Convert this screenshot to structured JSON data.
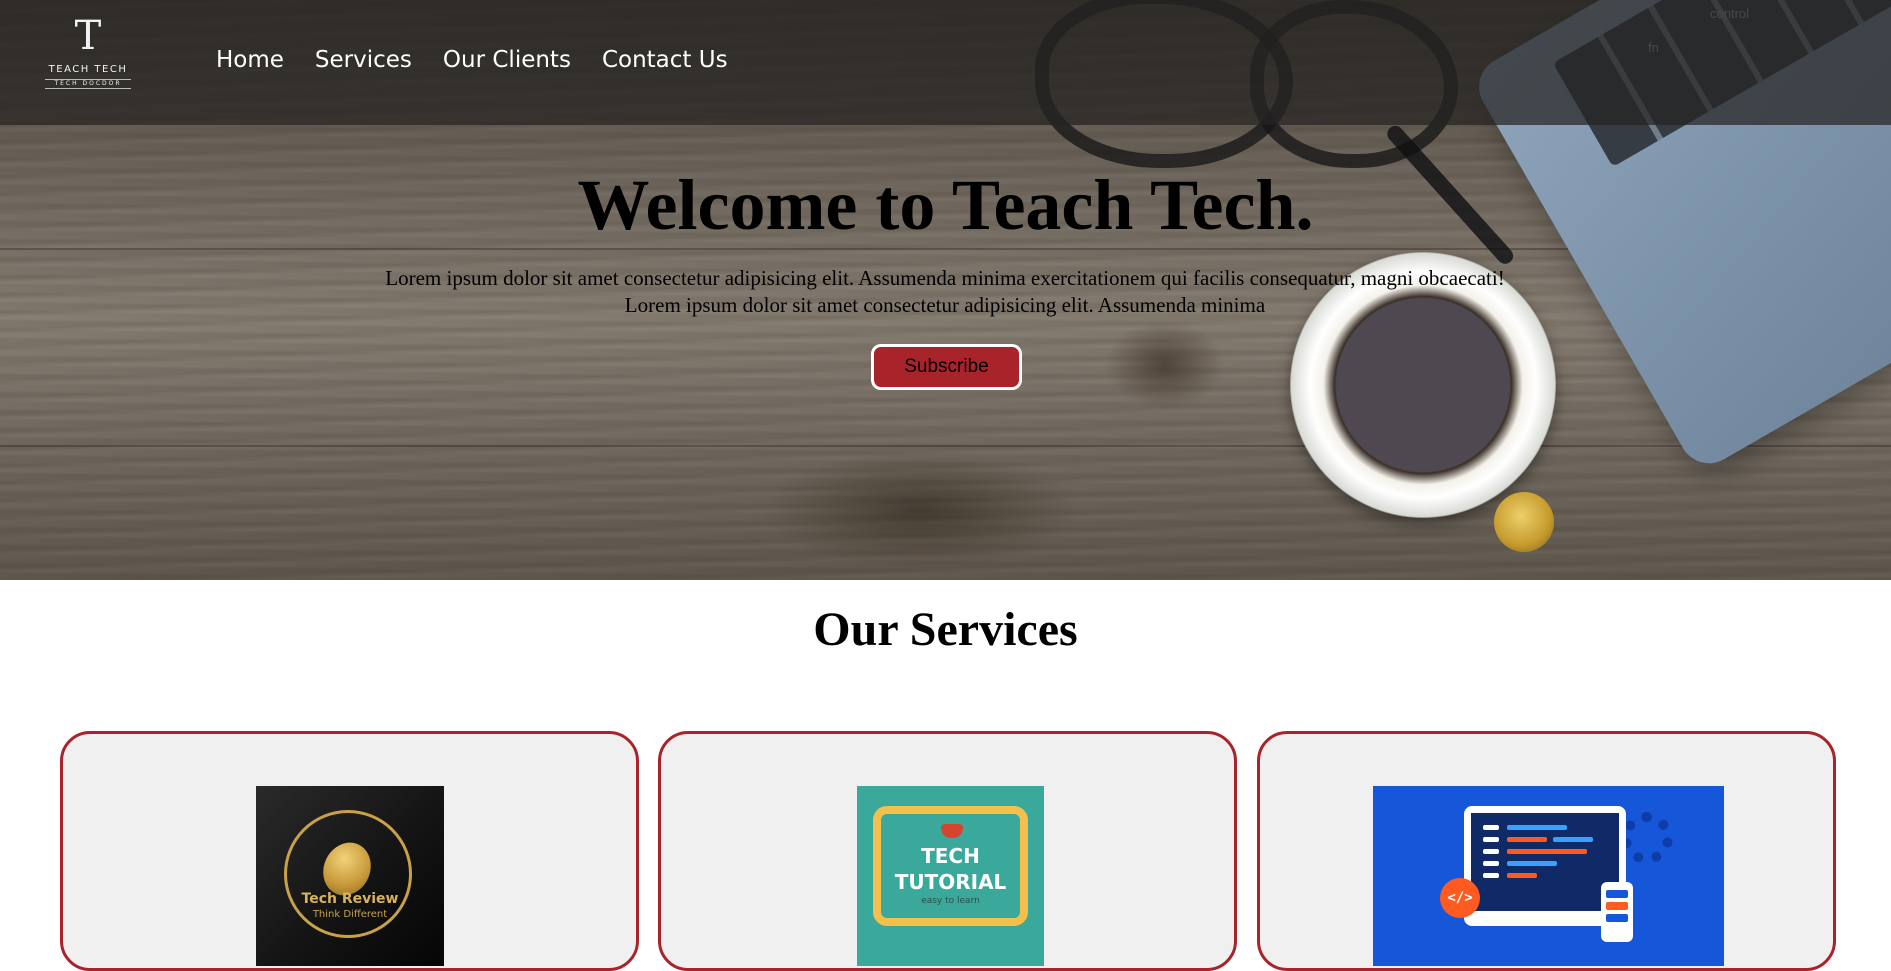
{
  "brand": {
    "logo_mark": "T",
    "logo_name": "TEACH TECH",
    "logo_tagline": "TECH DOCDOR"
  },
  "nav": {
    "items": [
      {
        "label": "Home"
      },
      {
        "label": "Services"
      },
      {
        "label": "Our Clients"
      },
      {
        "label": "Contact Us"
      }
    ]
  },
  "hero": {
    "title": "Welcome to Teach Tech.",
    "text_line1": "Lorem ipsum dolor sit amet consectetur adipisicing elit. Assumenda minima exercitationem qui facilis consequatur, magni obcaecati!",
    "text_line2": "Lorem ipsum dolor sit amet consectetur adipisicing elit. Assumenda minima",
    "button_label": "Subscribe",
    "laptop_keys": [
      "fn",
      "control"
    ]
  },
  "services": {
    "title": "Our Services",
    "cards": [
      {
        "image_title": "Tech Review",
        "image_subtitle": "Think Different"
      },
      {
        "image_title_1": "TECH",
        "image_title_2": "TUTORIAL",
        "image_subtitle": "easy to learn"
      },
      {
        "badge": "</>"
      }
    ]
  },
  "colors": {
    "accent": "#a8232a",
    "card_background": "#f0f0f0",
    "navbar_overlay": "rgba(38,36,34,0.72)"
  }
}
